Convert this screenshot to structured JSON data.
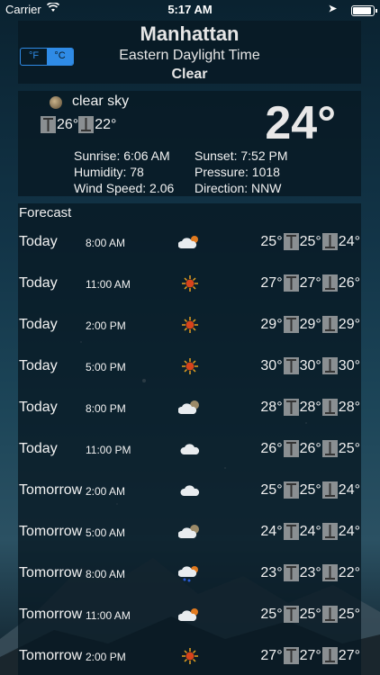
{
  "status_bar": {
    "carrier": "Carrier",
    "time": "5:17 AM"
  },
  "header": {
    "city": "Manhattan",
    "timezone": "Eastern Daylight Time",
    "condition": "Clear",
    "unit_toggle": {
      "f_label": "°F",
      "c_label": "°C",
      "selected": "°C"
    }
  },
  "current": {
    "icon": "moon-icon",
    "description": "clear sky",
    "high": "26°",
    "low": "22°",
    "temp": "24°",
    "sunrise": "Sunrise: 6:06 AM",
    "sunset": "Sunset: 7:52 PM",
    "humidity": "Humidity: 78",
    "pressure": "Pressure: 1018",
    "wind_speed": "Wind Speed: 2.06",
    "direction": "Direction: NNW"
  },
  "forecast": {
    "title": "Forecast",
    "rows": [
      {
        "day": "Today",
        "time": "8:00 AM",
        "icon": "cloud-sun-icon",
        "temp": "25°",
        "high": "25°",
        "low": "24°"
      },
      {
        "day": "Today",
        "time": "11:00 AM",
        "icon": "sun-icon",
        "temp": "27°",
        "high": "27°",
        "low": "26°"
      },
      {
        "day": "Today",
        "time": "2:00 PM",
        "icon": "sun-icon",
        "temp": "29°",
        "high": "29°",
        "low": "29°"
      },
      {
        "day": "Today",
        "time": "5:00 PM",
        "icon": "sun-icon",
        "temp": "30°",
        "high": "30°",
        "low": "30°"
      },
      {
        "day": "Today",
        "time": "8:00 PM",
        "icon": "cloud-moon-icon",
        "temp": "28°",
        "high": "28°",
        "low": "28°"
      },
      {
        "day": "Today",
        "time": "11:00 PM",
        "icon": "cloud-icon",
        "temp": "26°",
        "high": "26°",
        "low": "25°"
      },
      {
        "day": "Tomorrow",
        "time": "2:00 AM",
        "icon": "cloud-icon",
        "temp": "25°",
        "high": "25°",
        "low": "24°"
      },
      {
        "day": "Tomorrow",
        "time": "5:00 AM",
        "icon": "cloud-moon-icon",
        "temp": "24°",
        "high": "24°",
        "low": "24°"
      },
      {
        "day": "Tomorrow",
        "time": "8:00 AM",
        "icon": "rain-sun-icon",
        "temp": "23°",
        "high": "23°",
        "low": "22°"
      },
      {
        "day": "Tomorrow",
        "time": "11:00 AM",
        "icon": "cloud-sun-icon",
        "temp": "25°",
        "high": "25°",
        "low": "25°"
      },
      {
        "day": "Tomorrow",
        "time": "2:00 PM",
        "icon": "sun-icon",
        "temp": "27°",
        "high": "27°",
        "low": "27°"
      }
    ]
  },
  "colors": {
    "accent": "#2f8be6",
    "panel": "#08182299"
  }
}
